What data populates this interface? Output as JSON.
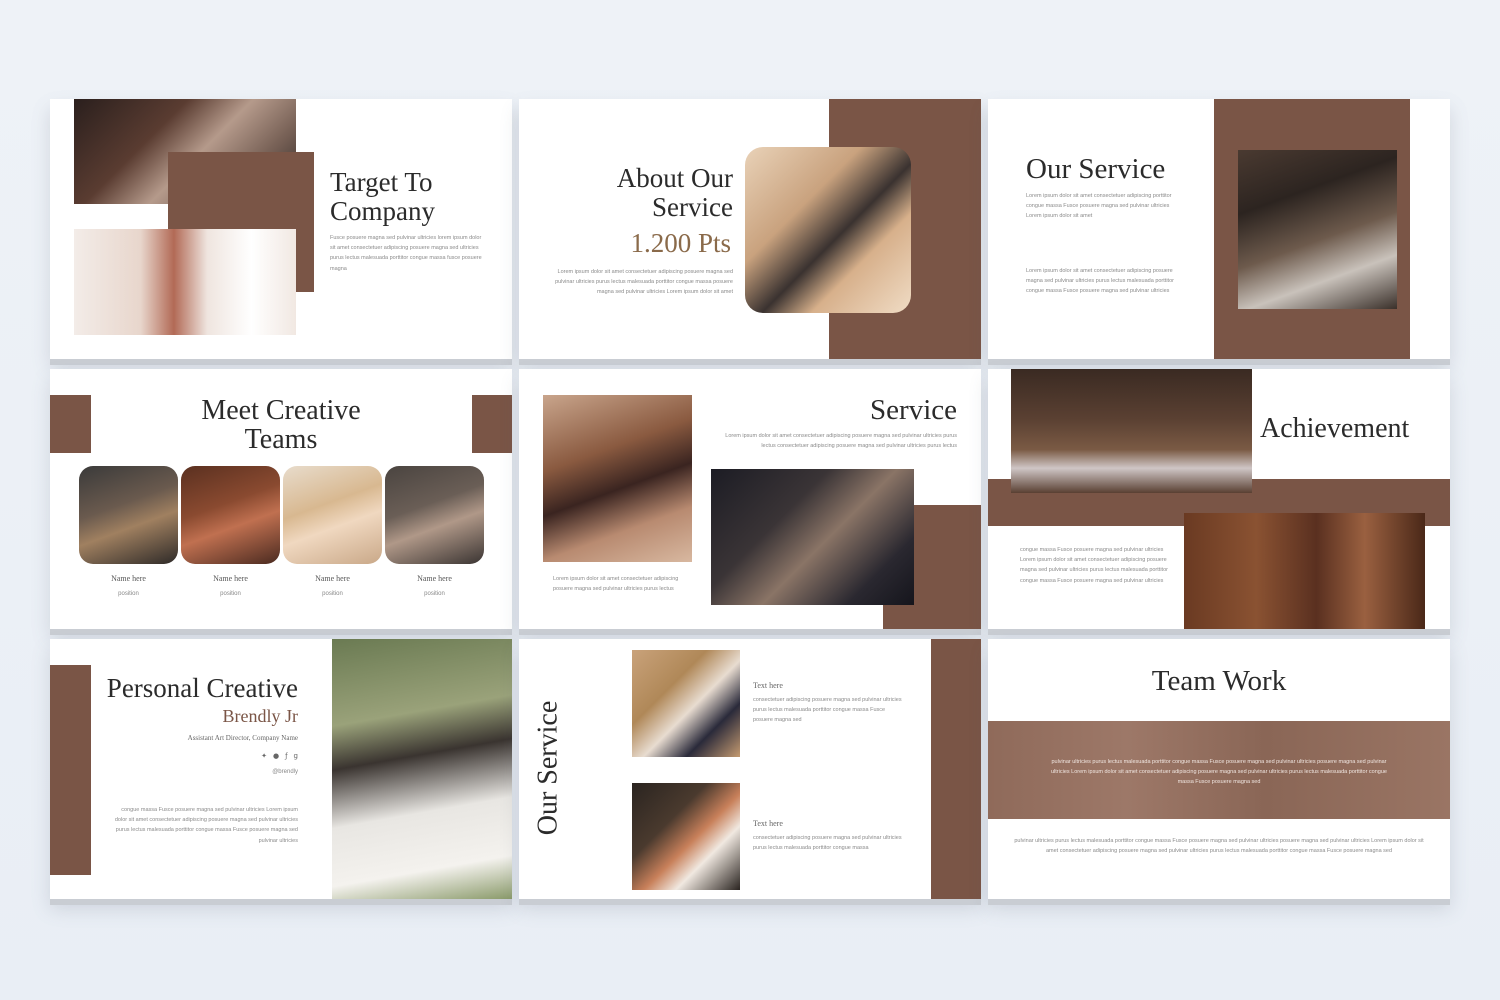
{
  "slides": {
    "s1": {
      "title_line1": "Target To",
      "title_line2": "Company",
      "body": "Fusce posuere magna sed pulvinar ultricies lorem ipsum dolor sit amet consectetuer adipiscing posuere magna sed ultricies purus lectus malesuada porttitor congue massa fusce posuere magna"
    },
    "s2": {
      "title_line1": "About Our",
      "title_line2": "Service",
      "points": "1.200 Pts",
      "body": "Lorem ipsum dolor sit amet consectetuer adipiscing posuere magna sed pulvinar ultricies purus lectus malesuada porttitor congue massa posuere magna sed pulvinar ultricies Lorem ipsum dolor sit amet"
    },
    "s3": {
      "title": "Our Service",
      "body1": "Lorem ipsum dolor sit amet consectetuer adipiscing porttitor congue massa Fusce posuere magna sed pulvinar ultricies Lorem ipsum dolor sit amet",
      "body2": "Lorem ipsum dolor sit amet consectetuer adipiscing posuere magna sed pulvinar ultricies purus lectus malesuada porttitor congue massa Fusce posuere magna sed pulvinar ultricies"
    },
    "s4": {
      "title_line1": "Meet Creative",
      "title_line2": "Teams",
      "members": [
        {
          "name": "Name here",
          "position": "position"
        },
        {
          "name": "Name here",
          "position": "position"
        },
        {
          "name": "Name here",
          "position": "position"
        },
        {
          "name": "Name here",
          "position": "position"
        }
      ]
    },
    "s5": {
      "title": "Service",
      "body_top": "Lorem ipsum dolor sit amet consectetuer adipiscing posuere magna sed pulvinar ultricies purus lectus consectetuer adipiscing posuere magna sed pulvinar ultricies purus lectus",
      "body_bottom": "Lorem ipsum dolor sit amet consectetuer adipiscing posuere magna sed pulvinar ultricies purus lectus"
    },
    "s6": {
      "title": "Achievement",
      "body": "congue massa Fusce posuere magna sed pulvinar ultricies Lorem ipsum dolor sit amet consectetuer adipiscing posuere magna sed pulvinar ultricies purus lectus malesuada porttitor congue massa Fusce posuere magna sed pulvinar ultricies"
    },
    "s7": {
      "title": "Personal Creative",
      "name": "Brendly Jr",
      "role": "Assistant Art Director, Company Name",
      "handle": "@brendly",
      "social": [
        "twitter-icon",
        "pinterest-icon",
        "facebook-icon",
        "googleplus-icon"
      ],
      "body": "congue massa Fusce posuere magna sed pulvinar ultricies Lorem ipsum dolor sit amet consectetuer adipiscing posuere magna sed pulvinar ultricies purus lectus malesuada porttitor congue massa Fusce posuere magna sed pulvinar ultricies"
    },
    "s8": {
      "title": "Our Service",
      "item1_label": "Text here",
      "item1_body": "consectetuer adipiscing posuere magna sed pulvinar ultricies purus lectus malesuada porttitor congue massa Fusce posuere magna sed",
      "item2_label": "Text here",
      "item2_body": "consectetuer adipiscing posuere magna sed pulvinar ultricies purus lectus malesuada porttitor congue massa"
    },
    "s9": {
      "title": "Team Work",
      "overlay_body": "pulvinar ultricies purus lectus malesuada porttitor congue massa Fusce posuere magna sed pulvinar ultricies posuere magna sed pulvinar ultricies Lorem ipsum dolor sit amet consectetuer adipiscing posuere magna sed pulvinar ultricies purus lectus malesuada porttitor congue massa Fusce posuere magna sed",
      "body": "pulvinar ultricies purus lectus malesuada porttitor congue massa Fusce posuere magna sed pulvinar ultricies posuere magna sed pulvinar ultricies Lorem ipsum dolor sit amet consectetuer adipiscing posuere magna sed pulvinar ultricies purus lectus malesuada porttitor congue massa Fusce posuere magna sed"
    }
  },
  "colors": {
    "brand_brown": "#7a5546",
    "points_brown": "#8a6a4a",
    "background": "#eef2f7"
  }
}
